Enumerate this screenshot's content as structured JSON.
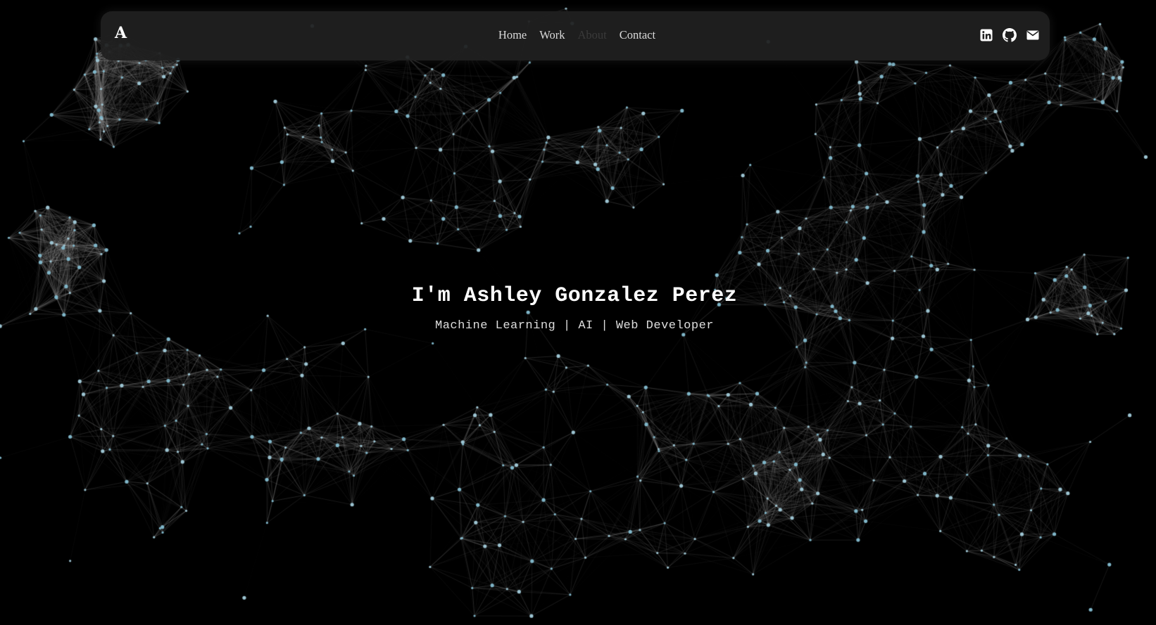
{
  "nav": {
    "logo": "A",
    "links": [
      {
        "label": "Home"
      },
      {
        "label": "Work"
      },
      {
        "label": "About",
        "active": true
      },
      {
        "label": "Contact"
      }
    ],
    "socials": [
      {
        "icon": "linkedin-icon"
      },
      {
        "icon": "github-icon"
      },
      {
        "icon": "envelope-icon"
      }
    ]
  },
  "hero": {
    "title": "I'm Ashley Gonzalez Perez",
    "subtitle": "Machine Learning | AI | Web Developer"
  },
  "colors": {
    "background": "#000000",
    "nodes": "#7fb6c9",
    "edges": "#8a8a8a",
    "navbar": "#202020",
    "active_link": "#3a3a3a"
  }
}
